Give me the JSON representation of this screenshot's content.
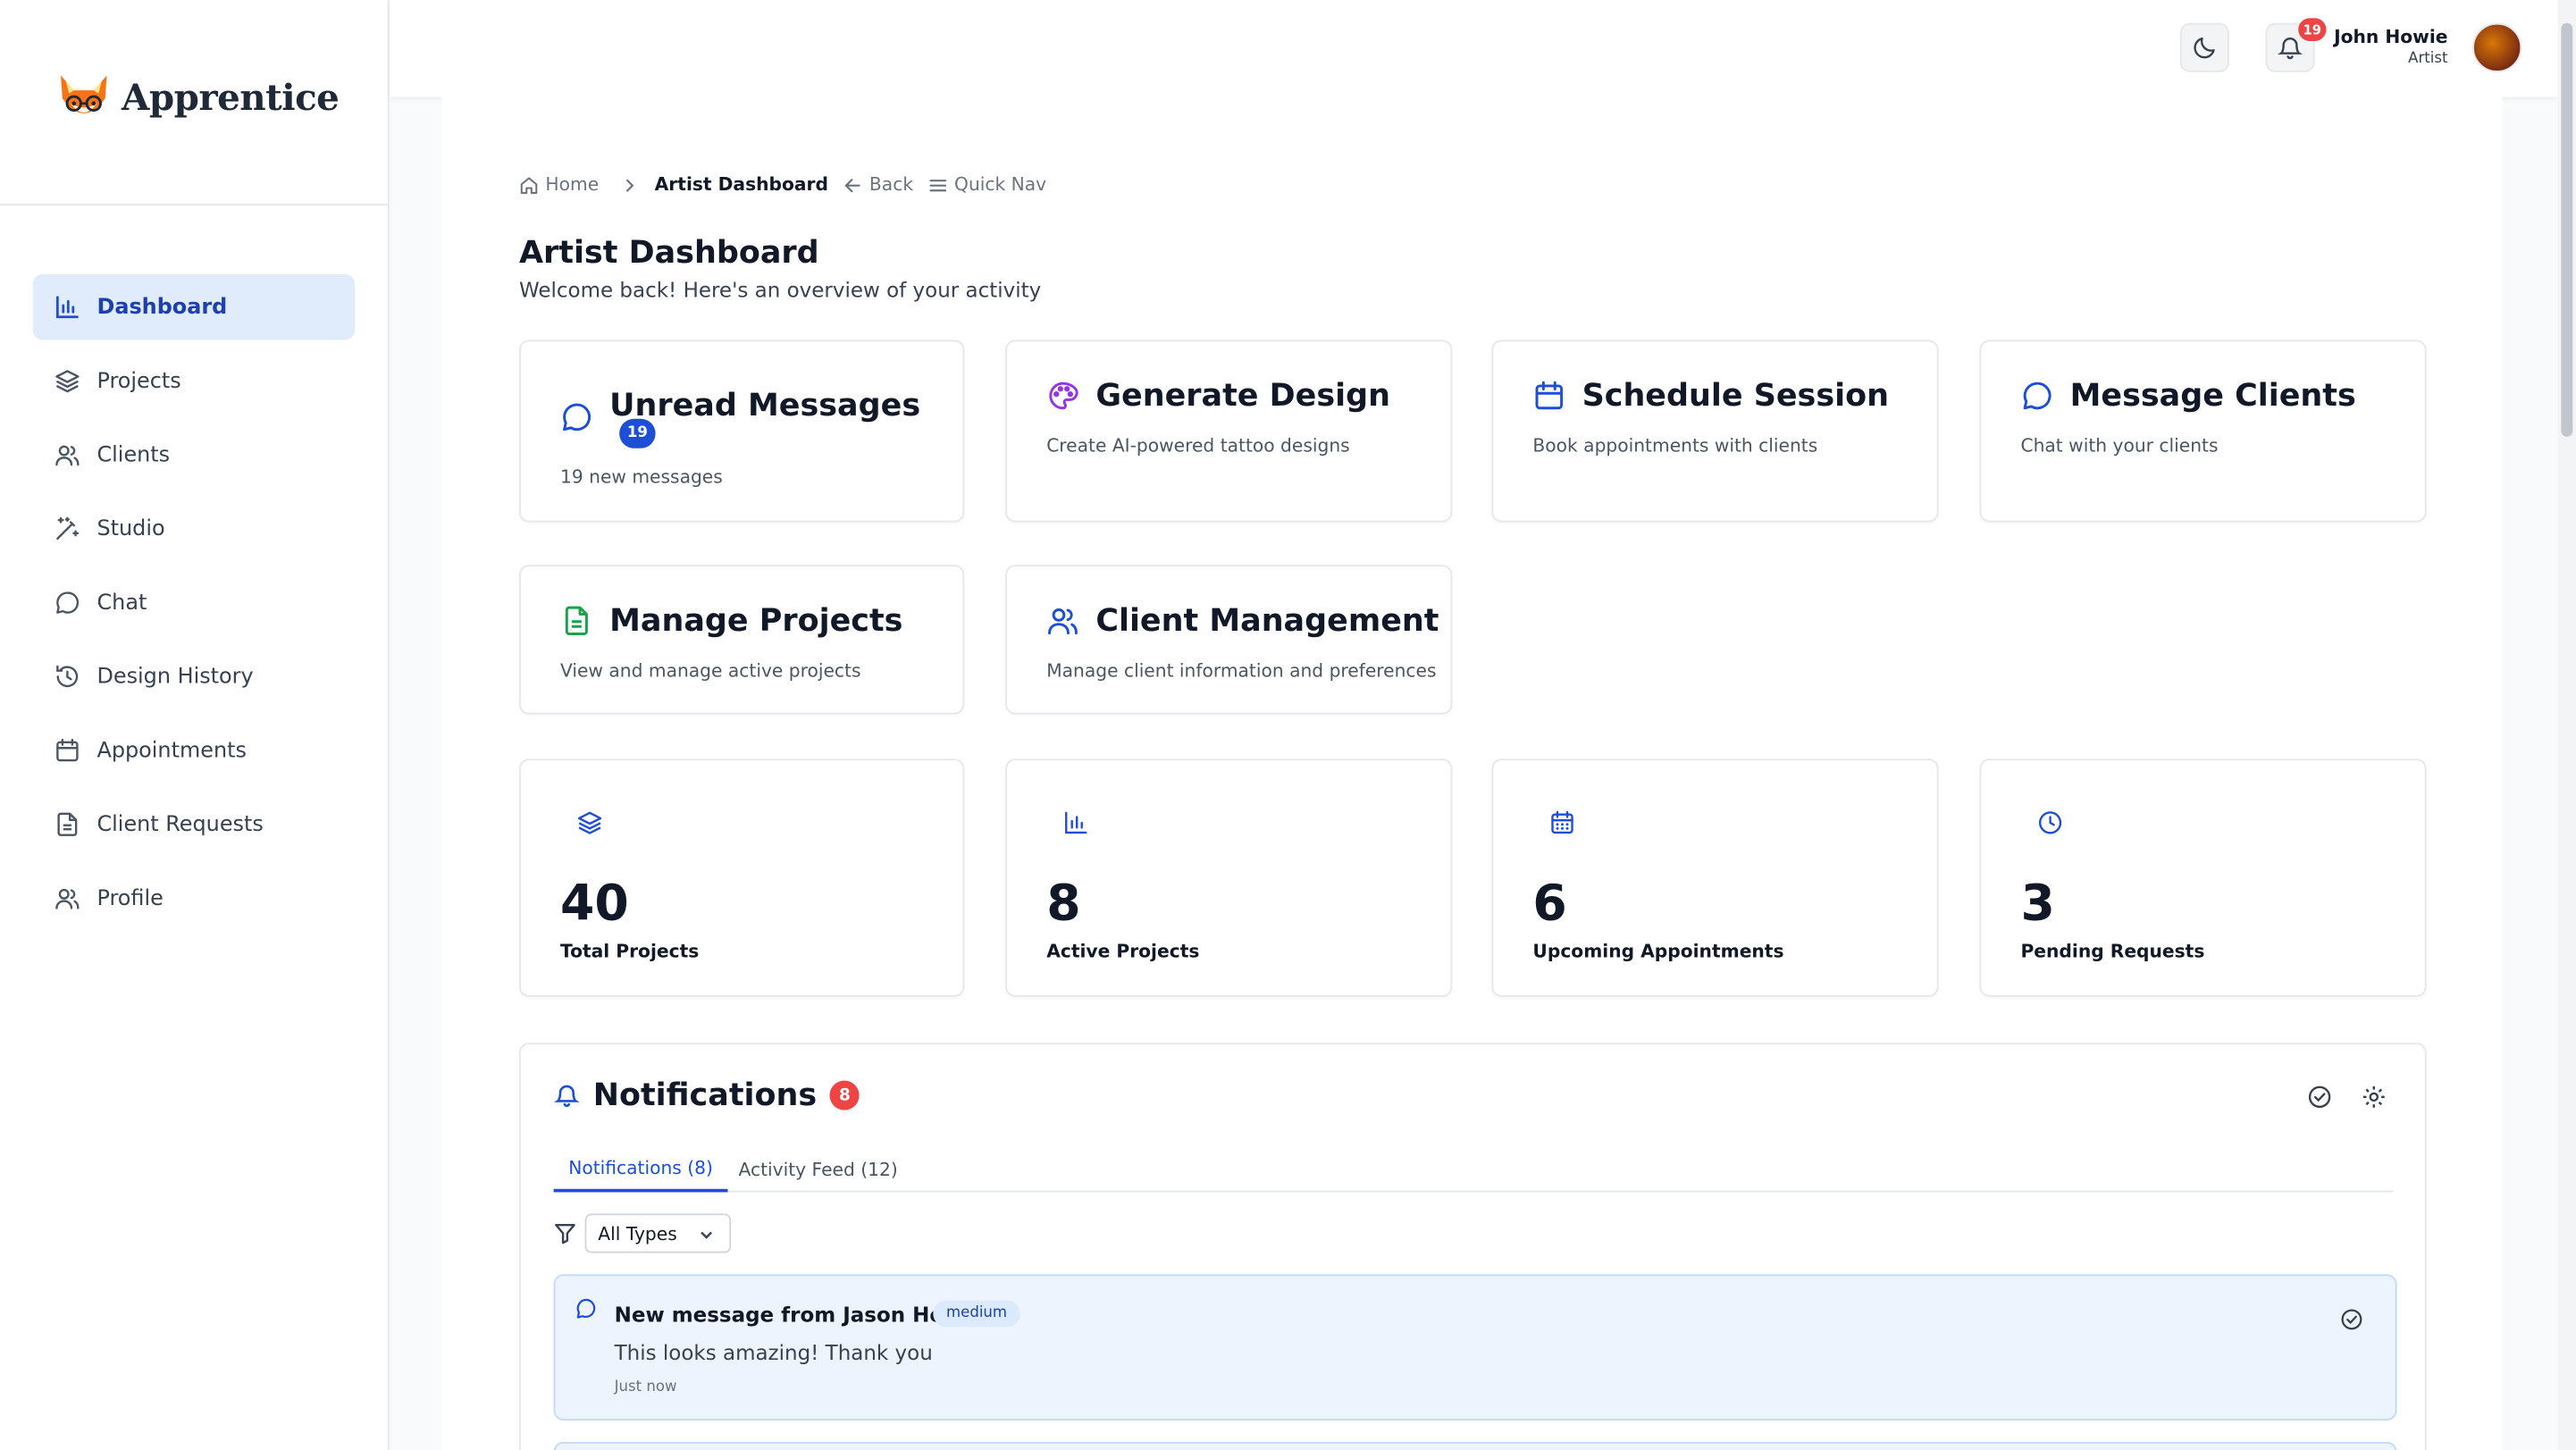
{
  "app": {
    "name": "Apprentice"
  },
  "colors": {
    "primary": "#1d4ed8",
    "active_nav_bg": "#e0ebfb",
    "badge_red": "#ef4444",
    "purple": "#9333ea",
    "green": "#16a34a"
  },
  "sidebar": {
    "items": [
      {
        "label": "Dashboard",
        "icon": "bar-chart-icon",
        "active": true
      },
      {
        "label": "Projects",
        "icon": "layers-icon"
      },
      {
        "label": "Clients",
        "icon": "users-icon"
      },
      {
        "label": "Studio",
        "icon": "magic-wand-icon"
      },
      {
        "label": "Chat",
        "icon": "chat-icon"
      },
      {
        "label": "Design History",
        "icon": "history-icon"
      },
      {
        "label": "Appointments",
        "icon": "calendar-icon"
      },
      {
        "label": "Client Requests",
        "icon": "document-icon"
      },
      {
        "label": "Profile",
        "icon": "user-icon"
      }
    ]
  },
  "topbar": {
    "notification_count": "19",
    "user": {
      "name": "John Howie",
      "role": "Artist"
    }
  },
  "breadcrumb": {
    "home": "Home",
    "current": "Artist Dashboard",
    "back": "Back",
    "quick_nav": "Quick Nav"
  },
  "page": {
    "title": "Artist Dashboard",
    "subtitle": "Welcome back! Here's an overview of your activity"
  },
  "action_cards": [
    {
      "title": "Unread Messages",
      "badge": "19",
      "description": "19 new messages",
      "icon": "chat-bubble-icon"
    },
    {
      "title": "Generate Design",
      "description": "Create AI-powered tattoo designs",
      "icon": "palette-icon"
    },
    {
      "title": "Schedule Session",
      "description": "Book appointments with clients",
      "icon": "calendar-icon"
    },
    {
      "title": "Message Clients",
      "description": "Chat with your clients",
      "icon": "chat-bubble-icon"
    },
    {
      "title": "Manage Projects",
      "description": "View and manage active projects",
      "icon": "document-icon"
    },
    {
      "title": "Client Management",
      "description": "Manage client information and preferences",
      "icon": "users-icon"
    }
  ],
  "stats": [
    {
      "value": "40",
      "label": "Total Projects",
      "icon": "layers-icon"
    },
    {
      "value": "8",
      "label": "Active Projects",
      "icon": "bar-chart-icon"
    },
    {
      "value": "6",
      "label": "Upcoming Appointments",
      "icon": "calendar-icon"
    },
    {
      "value": "3",
      "label": "Pending Requests",
      "icon": "clock-icon"
    }
  ],
  "notifications": {
    "title": "Notifications",
    "count": "8",
    "tabs": [
      {
        "label": "Notifications (8)",
        "active": true
      },
      {
        "label": "Activity Feed (12)"
      }
    ],
    "filter": {
      "selected": "All Types"
    },
    "items": [
      {
        "title": "New message from Jason Howie",
        "priority": "medium",
        "body": "This looks amazing! Thank you",
        "time": "Just now"
      }
    ]
  }
}
